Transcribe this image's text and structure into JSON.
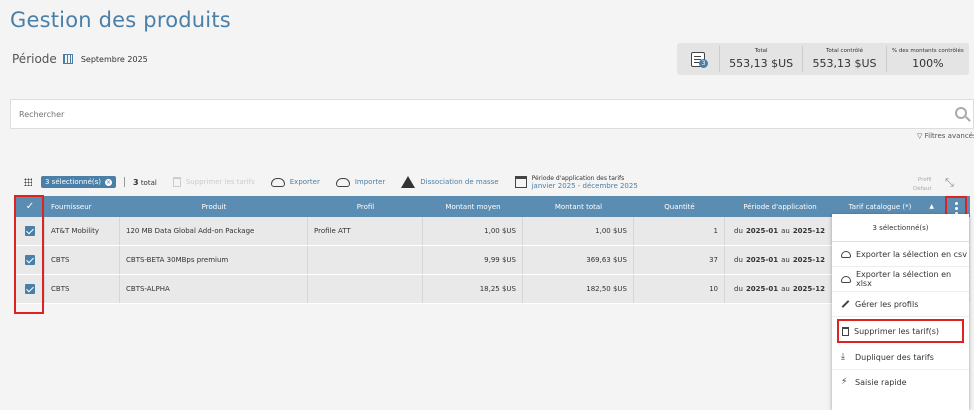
{
  "page": {
    "title": "Gestion des produits",
    "periode_label": "Période",
    "periode_value": "Septembre 2025"
  },
  "stats": {
    "badge": "3",
    "items": [
      {
        "label": "Total",
        "value": "553,13 $US"
      },
      {
        "label": "Total contrôlé",
        "value": "553,13 $US"
      },
      {
        "label": "% des montants contrôlés",
        "value": "100%"
      }
    ]
  },
  "search": {
    "placeholder": "Rechercher",
    "filters_label": "Filtres avancés"
  },
  "toolbar": {
    "selected": "3 sélectionné(s)",
    "total_count": "3",
    "total_label": "total",
    "delete_label": "Supprimer les tarifs",
    "export_label": "Exporter",
    "import_label": "Importer",
    "mass_label": "Dissociation de masse",
    "period_title": "Période d'application des tarifs",
    "period_value": "janvier 2025 - décembre 2025",
    "profil_label": "Profil",
    "profil_value": "Défaut"
  },
  "table": {
    "headers": [
      "Fournisseur",
      "Produit",
      "Profil",
      "Montant moyen",
      "Montant total",
      "Quantité",
      "Période d'application",
      "Tarif catalogue (*)"
    ],
    "rows": [
      {
        "fournisseur": "AT&T Mobility",
        "produit": "120 MB Data Global Add-on Package",
        "profil": "Profile ATT",
        "moyen": "1,00 $US",
        "total": "1,00 $US",
        "quantite": "1",
        "du": "du",
        "start": "2025-01",
        "au": "au",
        "end": "2025-12"
      },
      {
        "fournisseur": "CBTS",
        "produit": "CBTS-BETA 30MBps premium",
        "profil": "",
        "moyen": "9,99 $US",
        "total": "369,63 $US",
        "quantite": "37",
        "du": "du",
        "start": "2025-01",
        "au": "au",
        "end": "2025-12"
      },
      {
        "fournisseur": "CBTS",
        "produit": "CBTS-ALPHA",
        "profil": "",
        "moyen": "18,25 $US",
        "total": "182,50 $US",
        "quantite": "10",
        "du": "du",
        "start": "2025-01",
        "au": "au",
        "end": "2025-12"
      }
    ]
  },
  "menu": {
    "header": "3 sélectionné(s)",
    "items": [
      {
        "label": "Exporter la sélection en csv",
        "icon": "cloud-download-icon"
      },
      {
        "label": "Exporter la sélection en xlsx",
        "icon": "cloud-download-icon"
      },
      {
        "label": "Gérer les profils",
        "icon": "pencil-icon"
      },
      {
        "label": "Supprimer les tarif(s)",
        "icon": "trash-icon"
      },
      {
        "label": "Dupliquer des tarifs",
        "icon": "download-icon"
      },
      {
        "label": "Saisie rapide",
        "icon": "bolt-icon"
      }
    ]
  },
  "colors": {
    "accent": "#4a7fa8",
    "header_bg": "#5b8db3",
    "highlight": "#dd2222"
  }
}
